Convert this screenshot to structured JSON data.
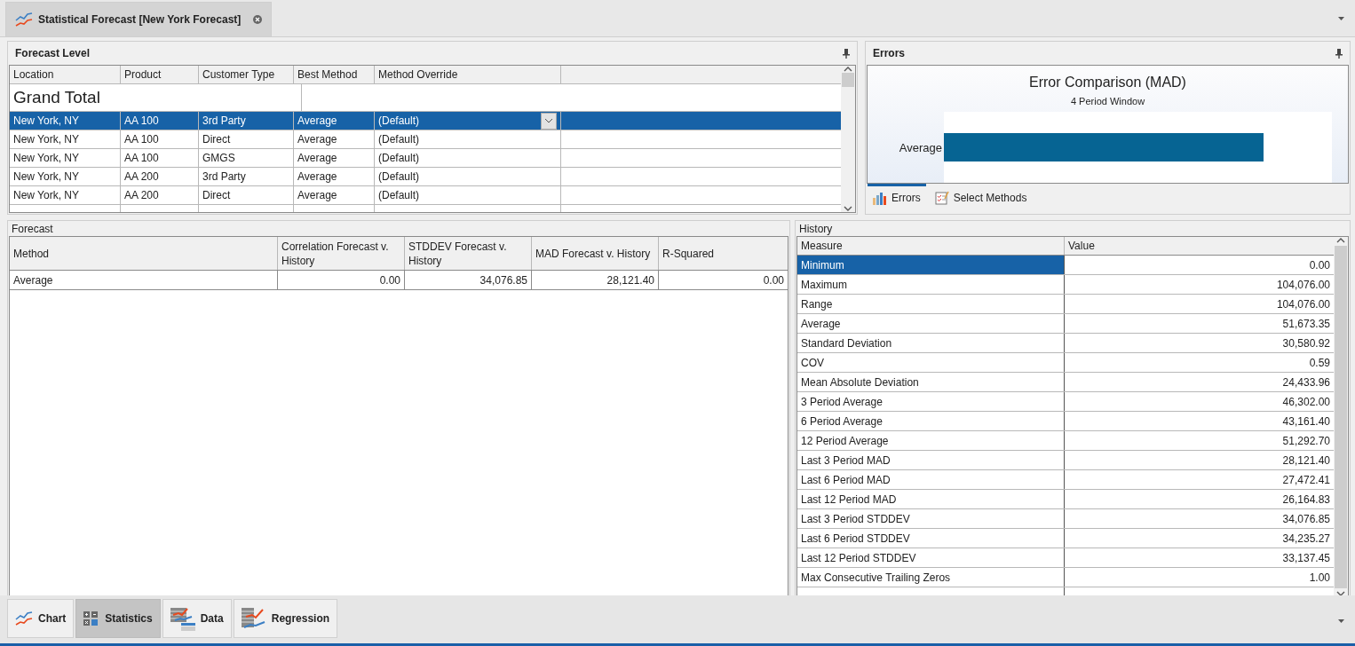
{
  "document_tab": {
    "title": "Statistical Forecast [New York Forecast]",
    "selected": true
  },
  "forecast_level": {
    "title": "Forecast Level",
    "columns": [
      "Location",
      "Product",
      "Customer Type",
      "Best Method",
      "Method Override"
    ],
    "grand_total": "Grand Total",
    "rows": [
      {
        "cells": [
          "New York, NY",
          "AA 100",
          "3rd Party",
          "Average",
          "(Default)"
        ],
        "selected": true
      },
      {
        "cells": [
          "New York, NY",
          "AA 100",
          "Direct",
          "Average",
          "(Default)"
        ],
        "selected": false
      },
      {
        "cells": [
          "New York, NY",
          "AA 100",
          "GMGS",
          "Average",
          "(Default)"
        ],
        "selected": false
      },
      {
        "cells": [
          "New York, NY",
          "AA 200",
          "3rd Party",
          "Average",
          "(Default)"
        ],
        "selected": false
      },
      {
        "cells": [
          "New York, NY",
          "AA 200",
          "Direct",
          "Average",
          "(Default)"
        ],
        "selected": false
      }
    ]
  },
  "errors": {
    "title": "Errors",
    "chart_title": "Error Comparison (MAD)",
    "chart_subtitle": "4 Period Window",
    "bar_label": "Average",
    "tabs": [
      {
        "label": "Errors",
        "selected": true,
        "kind": "bars"
      },
      {
        "label": "Select Methods",
        "selected": false,
        "kind": "checklist"
      }
    ]
  },
  "forecast": {
    "title": "Forecast",
    "columns": [
      "Method",
      "Correlation Forecast v. History",
      "STDDEV Forecast v. History",
      "MAD Forecast v. History",
      "R-Squared"
    ],
    "rows": [
      {
        "cells": [
          "Average",
          "0.00",
          "34,076.85",
          "28,121.40",
          "0.00"
        ]
      }
    ]
  },
  "history": {
    "title": "History",
    "columns": [
      "Measure",
      "Value"
    ],
    "rows": [
      {
        "measure": "Minimum",
        "value": "0.00",
        "selected": true
      },
      {
        "measure": "Maximum",
        "value": "104,076.00",
        "selected": false
      },
      {
        "measure": "Range",
        "value": "104,076.00",
        "selected": false
      },
      {
        "measure": "Average",
        "value": "51,673.35",
        "selected": false
      },
      {
        "measure": "Standard Deviation",
        "value": "30,580.92",
        "selected": false
      },
      {
        "measure": "COV",
        "value": "0.59",
        "selected": false
      },
      {
        "measure": "Mean Absolute Deviation",
        "value": "24,433.96",
        "selected": false
      },
      {
        "measure": "3 Period Average",
        "value": "46,302.00",
        "selected": false
      },
      {
        "measure": "6 Period Average",
        "value": "43,161.40",
        "selected": false
      },
      {
        "measure": "12 Period Average",
        "value": "51,292.70",
        "selected": false
      },
      {
        "measure": "Last 3 Period MAD",
        "value": "28,121.40",
        "selected": false
      },
      {
        "measure": "Last 6 Period MAD",
        "value": "27,472.41",
        "selected": false
      },
      {
        "measure": "Last 12 Period MAD",
        "value": "26,164.83",
        "selected": false
      },
      {
        "measure": "Last 3 Period STDDEV",
        "value": "34,076.85",
        "selected": false
      },
      {
        "measure": "Last 6 Period STDDEV",
        "value": "34,235.27",
        "selected": false
      },
      {
        "measure": "Last 12 Period STDDEV",
        "value": "33,137.45",
        "selected": false
      },
      {
        "measure": "Max Consecutive Trailing Zeros",
        "value": "1.00",
        "selected": false
      }
    ]
  },
  "bottom_tabs": [
    {
      "label": "Chart",
      "selected": false,
      "kind": "chart"
    },
    {
      "label": "Statistics",
      "selected": true,
      "kind": "statistics"
    },
    {
      "label": "Data",
      "selected": false,
      "kind": "data"
    },
    {
      "label": "Regression",
      "selected": false,
      "kind": "regression"
    }
  ]
}
